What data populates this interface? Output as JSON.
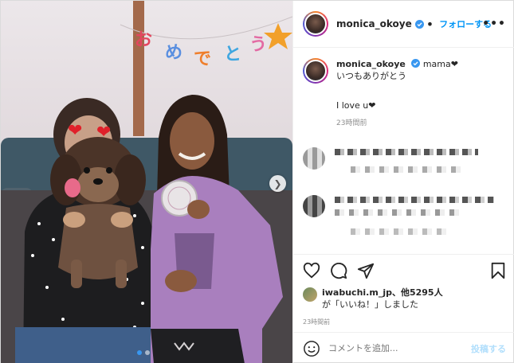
{
  "header": {
    "username": "monica_okoye",
    "follow_label": "フォローする",
    "more_label": "•••"
  },
  "caption": {
    "username": "monica_okoye",
    "line1": "mama❤",
    "line2": "いつもありがとう",
    "line3": "I love u❤",
    "time": "23時間前"
  },
  "photo": {
    "banner_text": "おめでとう"
  },
  "likes": {
    "user": "iwabuchi.m_jp",
    "others": "、他5295人",
    "suffix": "が「いいね！」しました"
  },
  "post_time": "23時間前",
  "comment": {
    "placeholder": "コメントを追加...",
    "post_label": "投稿する"
  },
  "colors": {
    "accent": "#0095f6",
    "post_disabled": "#b2dffc",
    "secondary_text": "#8e8e8e"
  },
  "icons": [
    "verified-icon",
    "more-icon",
    "heart-icon",
    "comment-icon",
    "share-icon",
    "bookmark-icon",
    "emoji-icon",
    "chevron-right-icon"
  ]
}
